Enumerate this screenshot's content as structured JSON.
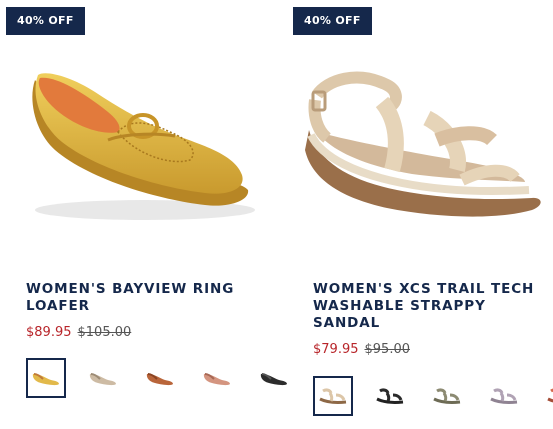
{
  "products": [
    {
      "badge": "40% OFF",
      "title": "WOMEN'S BAYVIEW RING LOAFER",
      "price_sale": "$89.95",
      "price_original": "$105.00",
      "image_icon": "yellow-loafer-image",
      "swatches": [
        {
          "name": "yellow",
          "color": "#e2b94a",
          "selected": true
        },
        {
          "name": "taupe",
          "color": "#cdbba4",
          "selected": false
        },
        {
          "name": "cognac",
          "color": "#b9653a",
          "selected": false
        },
        {
          "name": "blush",
          "color": "#d49580",
          "selected": false
        },
        {
          "name": "black",
          "color": "#2c2c2c",
          "selected": false
        }
      ]
    },
    {
      "badge": "40% OFF",
      "title": "WOMEN'S XCS TRAIL TECH WASHABLE STRAPPY SANDAL",
      "price_sale": "$79.95",
      "price_original": "$95.00",
      "image_icon": "beige-sandal-image",
      "swatches": [
        {
          "name": "beige",
          "color": "#dcc6a8",
          "selected": true
        },
        {
          "name": "black",
          "color": "#2a2a2a",
          "selected": false
        },
        {
          "name": "olive",
          "color": "#8c8a72",
          "selected": false
        },
        {
          "name": "lilac",
          "color": "#b0a2b4",
          "selected": false
        },
        {
          "name": "coral",
          "color": "#d66a4e",
          "selected": false
        }
      ]
    }
  ]
}
